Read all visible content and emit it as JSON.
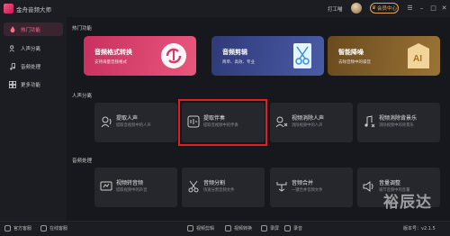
{
  "app": {
    "title": "金舟音频大师",
    "user": "打工喵",
    "vip_label": "会员中心"
  },
  "window_controls": [
    "minimize-icon",
    "maximize-icon",
    "close-icon"
  ],
  "sidebar": {
    "items": [
      {
        "label": "热门功能",
        "icon": "fire-icon",
        "active": true
      },
      {
        "label": "人声分离",
        "icon": "voice-icon",
        "active": false
      },
      {
        "label": "音频处理",
        "icon": "music-note-icon",
        "active": false
      },
      {
        "label": "更多功能",
        "icon": "grid-icon",
        "active": false
      }
    ]
  },
  "sections": {
    "hot": "热门功能",
    "vocal": "人声分离",
    "audio": "音频处理"
  },
  "featured": [
    {
      "title": "音频格式转换",
      "subtitle": "支持海量音频格式",
      "color": "#d83a6a"
    },
    {
      "title": "音频剪辑",
      "subtitle": "简单、高效、专业",
      "color": "#3b4a8f"
    },
    {
      "title": "智能降噪",
      "subtitle": "去除音频中的噪音",
      "color": "#7a5a2a"
    }
  ],
  "vocal_tools": [
    {
      "title": "提取人声",
      "subtitle": "提取音视频中的人声",
      "icon": "vocal-extract-icon"
    },
    {
      "title": "提取伴奏",
      "subtitle": "提取音视频中的伴奏",
      "icon": "accompaniment-icon"
    },
    {
      "title": "视频消除人声",
      "subtitle": "消除视频中的人声",
      "icon": "remove-vocal-icon"
    },
    {
      "title": "视频消除背景乐",
      "subtitle": "消除视频中的背景乐",
      "icon": "remove-bgm-icon"
    }
  ],
  "audio_tools": [
    {
      "title": "视频转音频",
      "subtitle": "提取视频中的声音",
      "icon": "video-to-audio-icon"
    },
    {
      "title": "音频分割",
      "subtitle": "快速分割音频文件",
      "icon": "scissors-icon"
    },
    {
      "title": "音频合并",
      "subtitle": "一键合并音频文件",
      "icon": "merge-icon"
    },
    {
      "title": "音量调整",
      "subtitle": "调节音频中的音量",
      "icon": "volume-icon"
    }
  ],
  "bottombar": {
    "left": [
      {
        "label": "官方客服",
        "icon": "headset-icon"
      },
      {
        "label": "在线客服",
        "icon": "chat-icon"
      }
    ],
    "center": [
      {
        "label": "视频剪辑",
        "icon": "video-edit-icon"
      },
      {
        "label": "视频转换",
        "icon": "video-convert-icon"
      },
      {
        "label": "录屏",
        "icon": "record-icon"
      },
      {
        "label": "录音",
        "icon": "mic-icon"
      }
    ],
    "version": "版本号：v2.1.5"
  },
  "watermark": "裕辰达"
}
